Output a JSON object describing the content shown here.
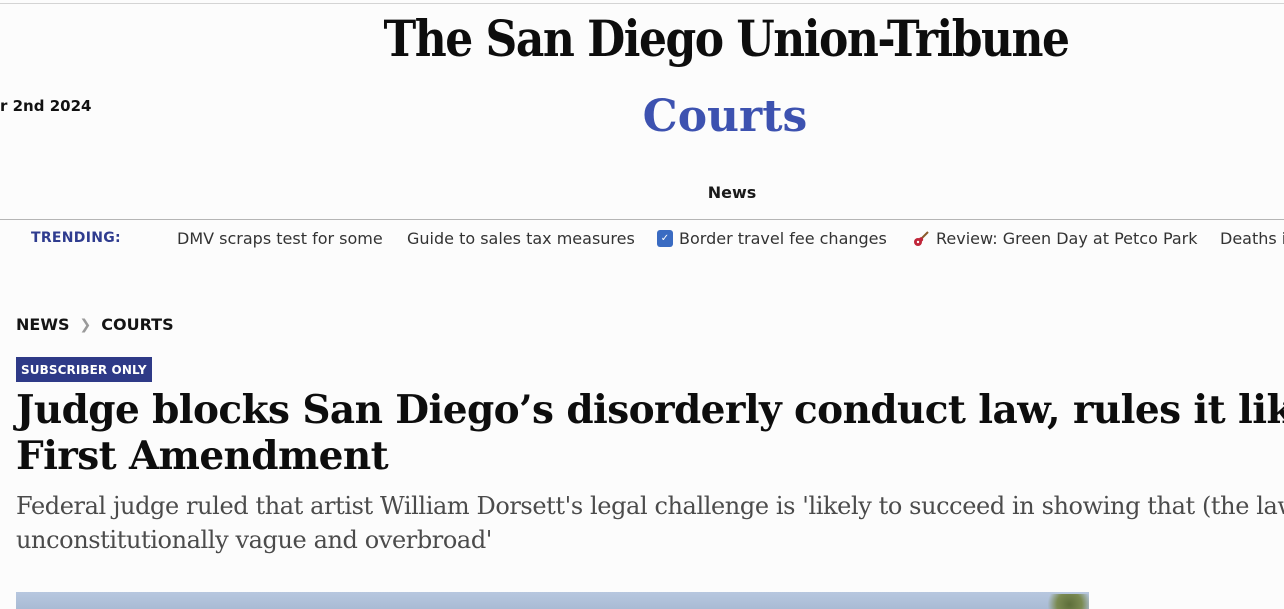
{
  "masthead": {
    "title": "The San Diego Union-Tribune"
  },
  "header": {
    "date": "r 2nd 2024",
    "section_title": "Courts",
    "section_link": "News"
  },
  "trending": {
    "label": "TRENDING:",
    "items": [
      {
        "label": "DMV scraps test for some",
        "icon": ""
      },
      {
        "label": "Guide to sales tax measures",
        "icon": ""
      },
      {
        "label": "Border travel fee changes",
        "icon": "shield-icon"
      },
      {
        "label": "Review: Green Day at Petco Park",
        "icon": "guitar-icon"
      },
      {
        "label": "Deaths i",
        "icon": ""
      }
    ]
  },
  "breadcrumb": {
    "items": [
      "NEWS",
      "COURTS"
    ]
  },
  "article": {
    "badge": "SUBSCRIBER ONLY",
    "headline_line1": "Judge blocks San Diego’s disorderly conduct law, rules it likely viol",
    "headline_line2": "First Amendment",
    "dek_line1": "Federal judge ruled that artist William Dorsett's legal challenge is 'likely to succeed in showing that (the law)",
    "dek_line2": "unconstitutionally vague and overbroad'"
  },
  "colors": {
    "accent": "#3d52b0",
    "badge_bg": "#2e3a87",
    "trending_label": "#2f3c8f"
  }
}
